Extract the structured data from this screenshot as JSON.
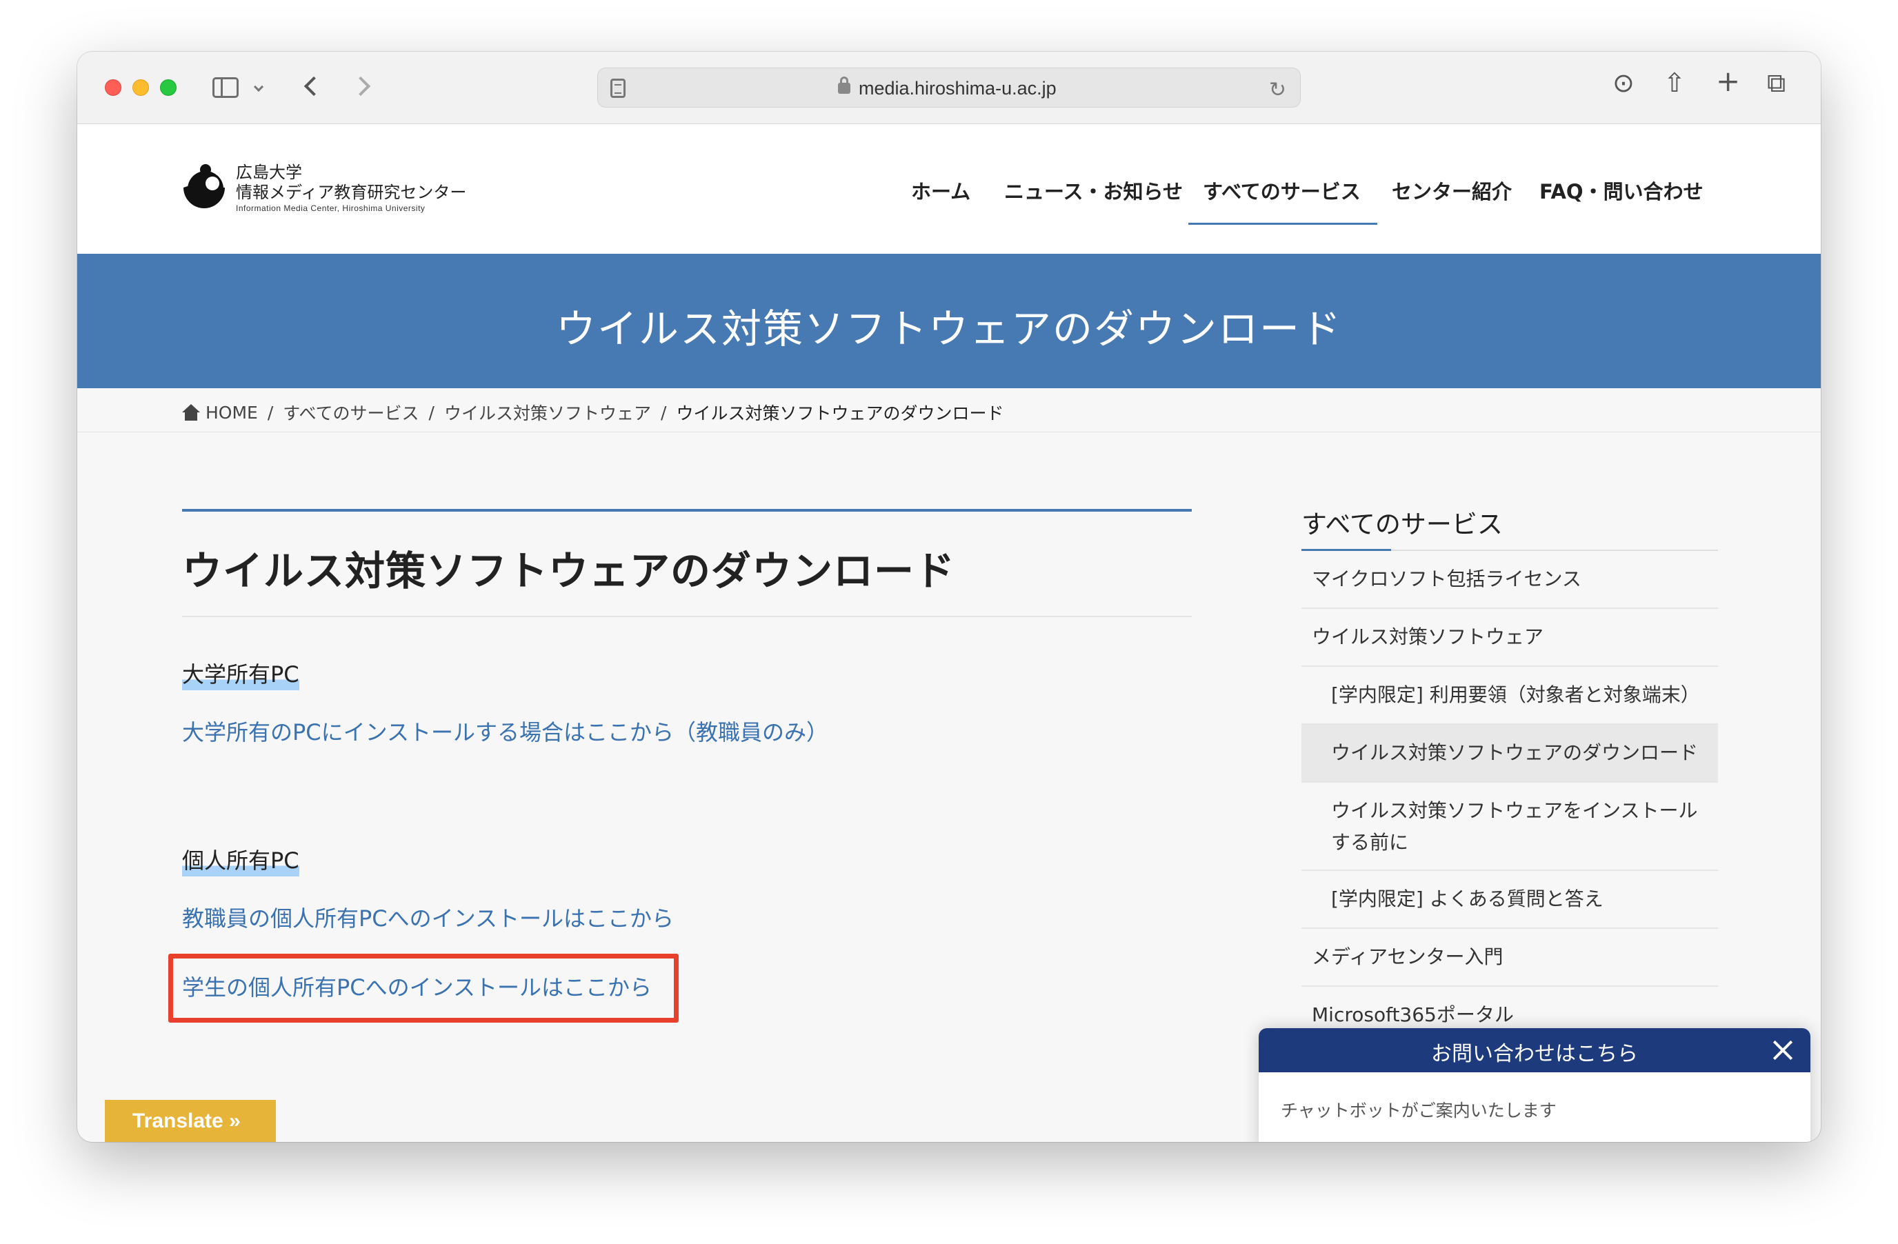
{
  "browser": {
    "url": "media.hiroshima-u.ac.jp"
  },
  "site": {
    "logo": {
      "line1": "広島大学",
      "line2": "情報メディア教育研究センター",
      "line3": "Information Media Center, Hiroshima University"
    },
    "nav": [
      {
        "label": "ホーム"
      },
      {
        "label": "ニュース・お知らせ"
      },
      {
        "label": "すべてのサービス"
      },
      {
        "label": "センター紹介"
      },
      {
        "label": "FAQ・問い合わせ"
      }
    ],
    "active_nav": "すべてのサービス"
  },
  "banner": {
    "title": "ウイルス対策ソフトウェアのダウンロード"
  },
  "breadcrumb": {
    "home": "HOME",
    "items": [
      "すべてのサービス",
      "ウイルス対策ソフトウェア"
    ],
    "current": "ウイルス対策ソフトウェアのダウンロード"
  },
  "content": {
    "title": "ウイルス対策ソフトウェアのダウンロード",
    "sections": [
      {
        "heading": "大学所有PC",
        "links": [
          "大学所有のPCにインストールする場合はここから（教職員のみ）"
        ]
      },
      {
        "heading": "個人所有PC",
        "links": [
          "教職員の個人所有PCへのインストールはここから",
          "学生の個人所有PCへのインストールはここから"
        ]
      }
    ]
  },
  "sidebar": {
    "title": "すべてのサービス",
    "items": [
      {
        "label": "マイクロソフト包括ライセンス"
      },
      {
        "label": "ウイルス対策ソフトウェア"
      },
      {
        "label": "[学内限定] 利用要領（対象者と対象端末）"
      },
      {
        "label": "ウイルス対策ソフトウェアのダウンロード"
      },
      {
        "label": "ウイルス対策ソフトウェアをインストール"
      },
      {
        "label": "する前に"
      },
      {
        "label": "[学内限定] よくある質問と答え"
      },
      {
        "label": "メディアセンター入門"
      },
      {
        "label": "Microsoft365ポータル"
      }
    ]
  },
  "translate": {
    "label": "Translate »"
  },
  "chat": {
    "title": "お問い合わせはこちら",
    "message": "チャットボットがご案内いたします"
  },
  "colors": {
    "accent": "#4779b3",
    "link": "#3b72b0",
    "highlight": "#e8402c",
    "translate": "#e7b43a",
    "chat_header": "#1d3a7c"
  }
}
